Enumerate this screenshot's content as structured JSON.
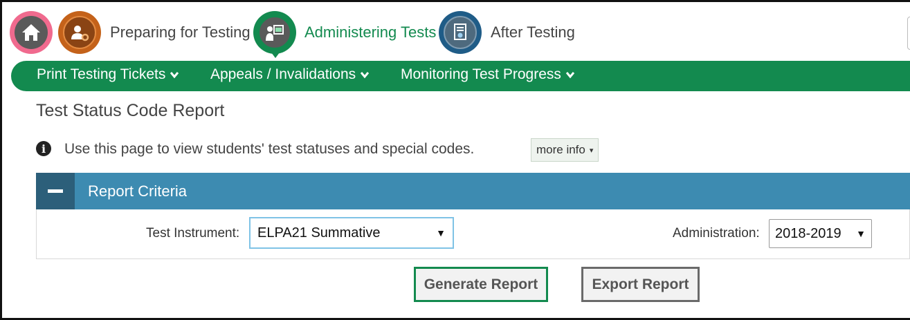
{
  "topnav": {
    "steps": [
      {
        "label": "Preparing for Testing"
      },
      {
        "label": "Administering Tests"
      },
      {
        "label": "After Testing"
      }
    ]
  },
  "menu": {
    "items": [
      {
        "label": "Print Testing Tickets"
      },
      {
        "label": "Appeals / Invalidations"
      },
      {
        "label": "Monitoring Test Progress"
      }
    ]
  },
  "page": {
    "title": "Test Status Code Report",
    "info_text": "Use this page to view students' test statuses and special codes.",
    "more_info_label": "more info"
  },
  "criteria": {
    "title": "Report Criteria",
    "test_instrument_label": "Test Instrument:",
    "test_instrument_value": "ELPA21 Summative",
    "administration_label": "Administration:",
    "administration_value": "2018-2019"
  },
  "buttons": {
    "generate": "Generate Report",
    "export": "Export Report"
  },
  "colors": {
    "green": "#138a4f",
    "panel_blue": "#3d8bb1",
    "panel_dark": "#2c5f7a",
    "home_ring": "#f06a8e",
    "prep_ring": "#c4621a",
    "after_ring": "#1f5c87"
  },
  "icons": {
    "home": "home-icon",
    "prep": "user-gear-icon",
    "admin": "presenter-icon",
    "after": "certificate-icon",
    "info": "info-icon",
    "chevron": "chevron-down-icon"
  }
}
